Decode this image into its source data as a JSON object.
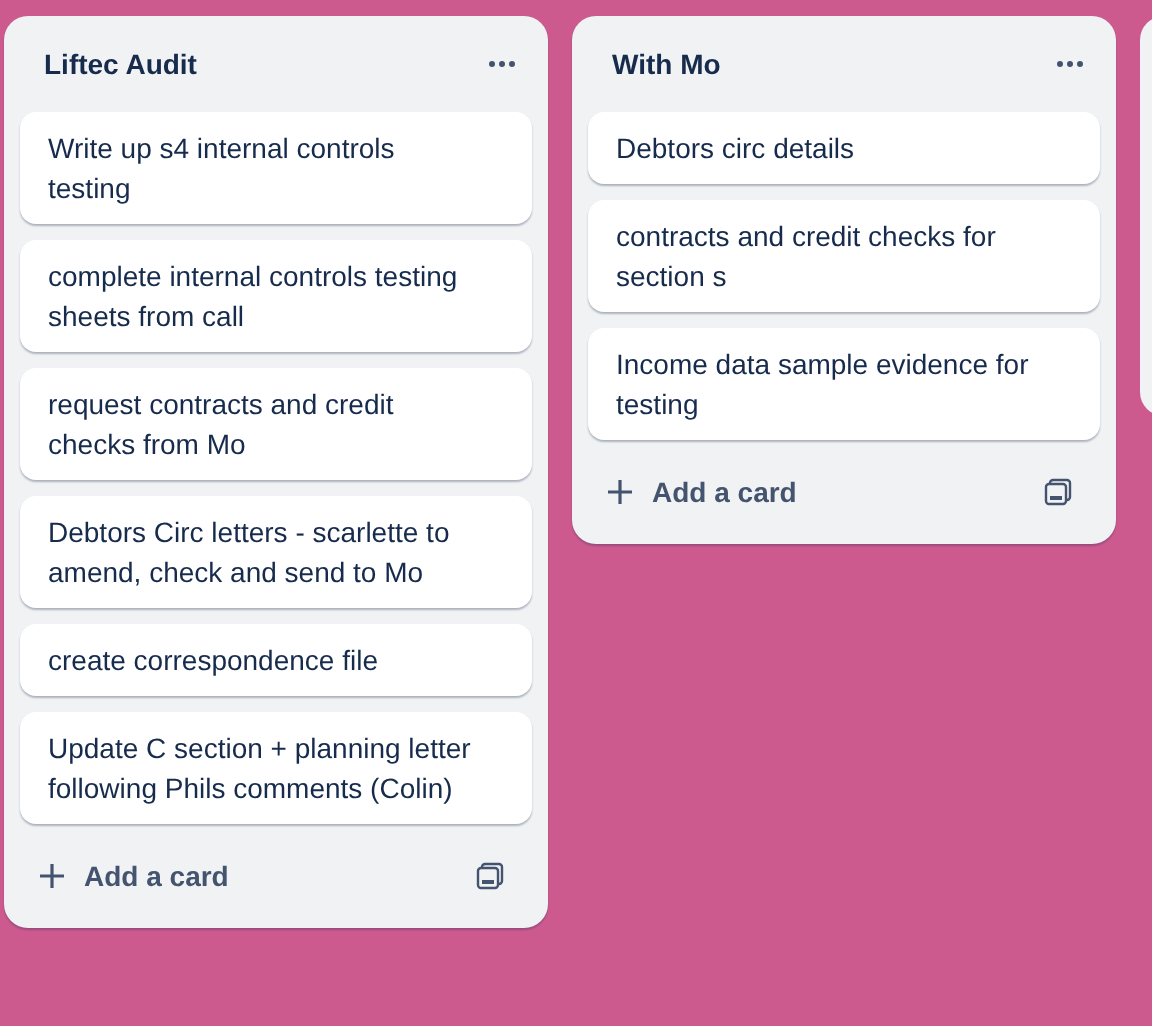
{
  "lists": [
    {
      "title": "Liftec Audit",
      "cards": [
        "Write up s4 internal controls testing",
        "complete internal controls testing sheets from call",
        "request contracts and credit checks from Mo",
        "Debtors Circ letters - scarlette to amend, check and send to Mo",
        "create correspondence file",
        "Update C section + planning letter following Phils comments (Colin)"
      ],
      "add_label": "Add a card"
    },
    {
      "title": "With Mo",
      "cards": [
        "Debtors circ details",
        "contracts and credit checks for section s",
        "Income data sample evidence for testing"
      ],
      "add_label": "Add a card"
    }
  ]
}
